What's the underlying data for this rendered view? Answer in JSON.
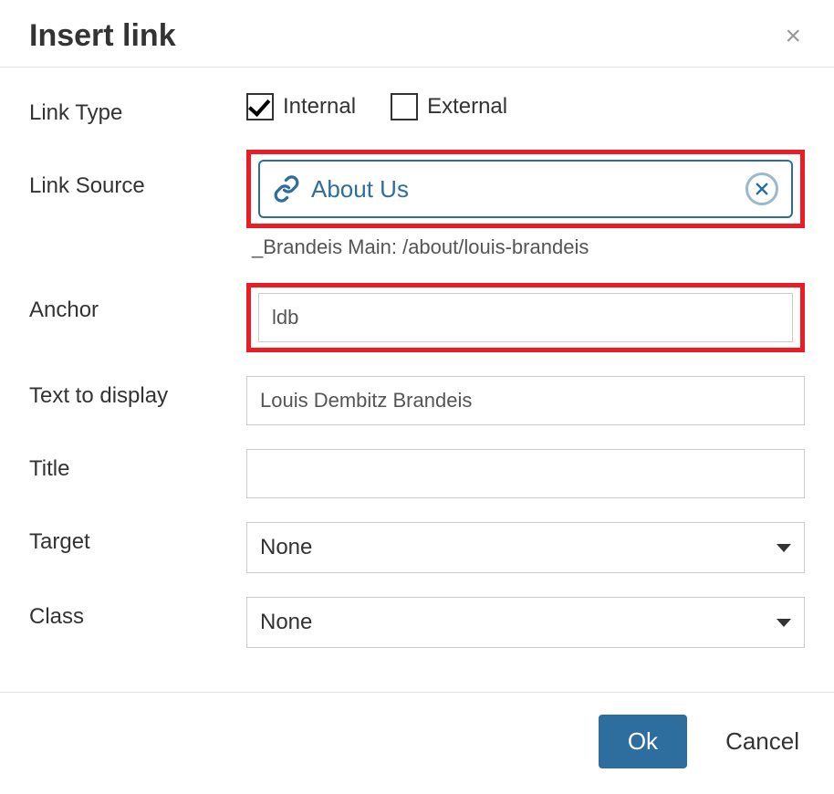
{
  "dialog": {
    "title": "Insert link",
    "close_glyph": "×"
  },
  "fields": {
    "link_type": {
      "label": "Link Type",
      "options": [
        {
          "label": "Internal",
          "checked": true
        },
        {
          "label": "External",
          "checked": false
        }
      ]
    },
    "link_source": {
      "label": "Link Source",
      "value": "About Us",
      "path": "_Brandeis Main: /about/louis-brandeis"
    },
    "anchor": {
      "label": "Anchor",
      "value": "ldb"
    },
    "text_to_display": {
      "label": "Text to display",
      "value": "Louis Dembitz Brandeis"
    },
    "title": {
      "label": "Title",
      "value": ""
    },
    "target": {
      "label": "Target",
      "value": "None"
    },
    "class_": {
      "label": "Class",
      "value": "None"
    }
  },
  "footer": {
    "ok": "Ok",
    "cancel": "Cancel"
  }
}
